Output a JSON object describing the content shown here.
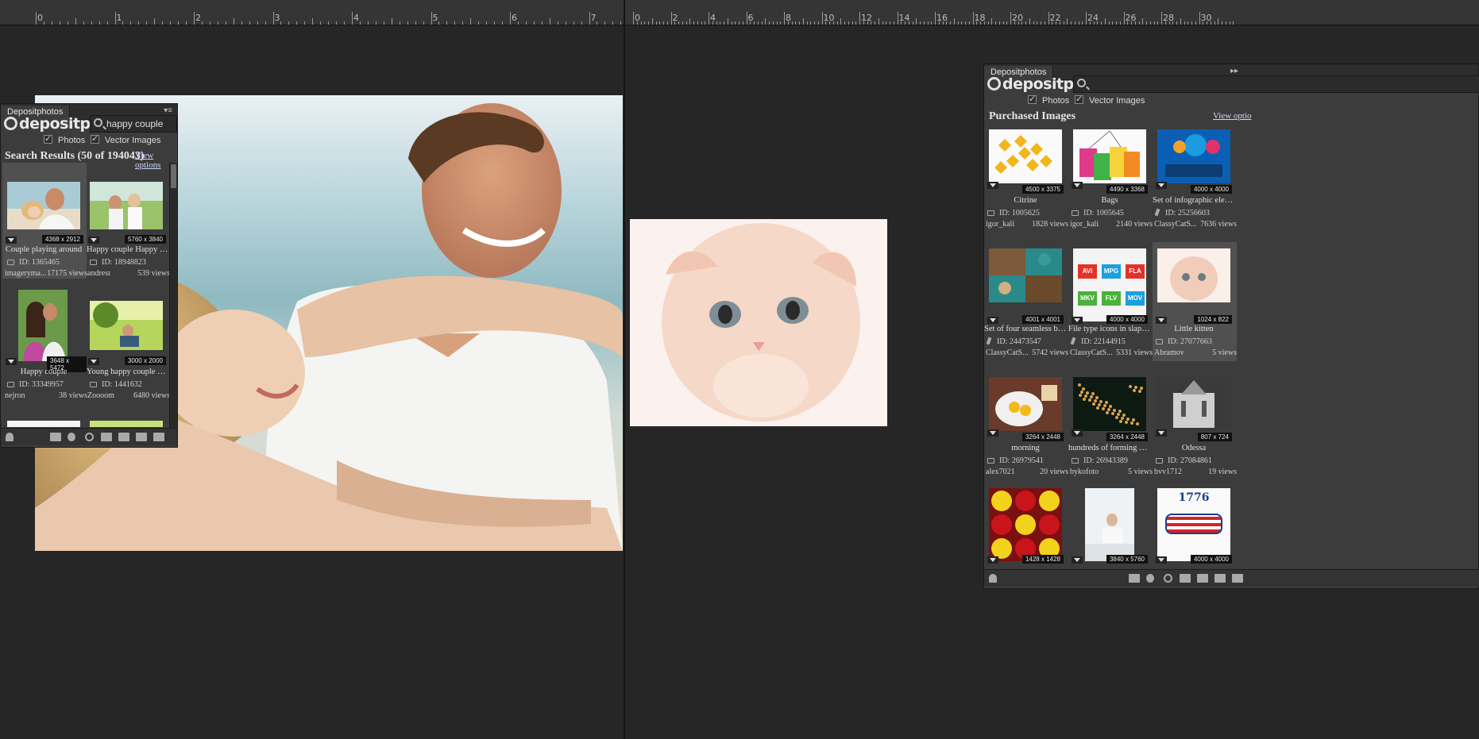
{
  "rulers": {
    "left_numbers": [
      "0",
      "1",
      "2",
      "3",
      "4",
      "5",
      "6",
      "7"
    ],
    "right_numbers": [
      "0",
      "2",
      "4",
      "6",
      "8",
      "10",
      "12",
      "14",
      "16",
      "18",
      "20",
      "22",
      "24",
      "26",
      "28",
      "30"
    ]
  },
  "left_panel": {
    "tab": "Depositphotos",
    "brand": "depositphotos",
    "search_value": "happy couple",
    "filter_photos": "Photos",
    "filter_vector": "Vector Images",
    "section_title": "Search Results (50 of 194043)",
    "view_options": "View options",
    "items": [
      {
        "dim": "4368 x 2912",
        "title": "Couple playing around",
        "id": "ID: 1365465",
        "user": "imageryma...",
        "views": "17175 views"
      },
      {
        "dim": "5760 x 3840",
        "title": "Happy couple Happy co...",
        "id": "ID: 18948823",
        "user": "andresr",
        "views": "539 views"
      },
      {
        "dim": "3648 x 5472",
        "title": "Happy couple",
        "id": "ID: 33349957",
        "user": "nejron",
        "views": "38 views"
      },
      {
        "dim": "3000 x 2000",
        "title": "Young happy couple ou...",
        "id": "ID: 1441632",
        "user": "Zoooom",
        "views": "6480 views"
      }
    ]
  },
  "right_panel": {
    "tab": "Depositphotos",
    "brand": "depositphotos",
    "search_value": "",
    "filter_photos": "Photos",
    "filter_vector": "Vector Images",
    "section_title": "Purchased Images",
    "view_options": "View optio",
    "items": [
      {
        "dim": "4500 x 3375",
        "title": "Citrine",
        "id": "ID: 1005625",
        "user": "igor_kali",
        "views": "1828 views",
        "kind": "photo"
      },
      {
        "dim": "4490 x 3368",
        "title": "Bags",
        "id": "ID: 1005645",
        "user": "igor_kali",
        "views": "2140 views",
        "kind": "photo"
      },
      {
        "dim": "4000 x 4000",
        "title": "Set of infographic eleme...",
        "id": "ID: 25256603",
        "user": "ClassyCatS...",
        "views": "7636 views",
        "kind": "vector"
      },
      {
        "dim": "4001 x 4001",
        "title": "Set of four seamless bac...",
        "id": "ID: 24473547",
        "user": "ClassyCatS...",
        "views": "5742 views",
        "kind": "vector"
      },
      {
        "dim": "4000 x 4000",
        "title": "File type icons in slapstic...",
        "id": "ID: 22144915",
        "user": "ClassyCatS...",
        "views": "5331 views",
        "kind": "vector"
      },
      {
        "dim": "1024 x 822",
        "title": "Little kitten",
        "id": "ID: 27077663",
        "user": "Abramov",
        "views": "5 views",
        "kind": "photo"
      },
      {
        "dim": "3264 x 2448",
        "title": "morning",
        "id": "ID: 26979541",
        "user": "alex7021",
        "views": "20 views",
        "kind": "photo"
      },
      {
        "dim": "3264 x 2448",
        "title": "hundreds of forming a h...",
        "id": "ID: 26943389",
        "user": "bykofoto",
        "views": "5 views",
        "kind": "photo"
      },
      {
        "dim": "807 x 724",
        "title": "Odessa",
        "id": "ID: 27084861",
        "user": "bvv1712",
        "views": "19 views",
        "kind": "photo"
      },
      {
        "dim": "1428 x 1428",
        "title": "",
        "id": "",
        "user": "",
        "views": "",
        "kind": "photo"
      },
      {
        "dim": "3840 x 5760",
        "title": "",
        "id": "",
        "user": "",
        "views": "",
        "kind": "photo"
      },
      {
        "dim": "4000 x 4000",
        "title": "",
        "id": "",
        "user": "",
        "views": "",
        "kind": "vector"
      }
    ],
    "thumb_text_mkv": [
      "AVI",
      "MPG",
      "FLA",
      "MKV",
      "FLV",
      "MOV"
    ],
    "thumb_text_1776": "1776"
  }
}
